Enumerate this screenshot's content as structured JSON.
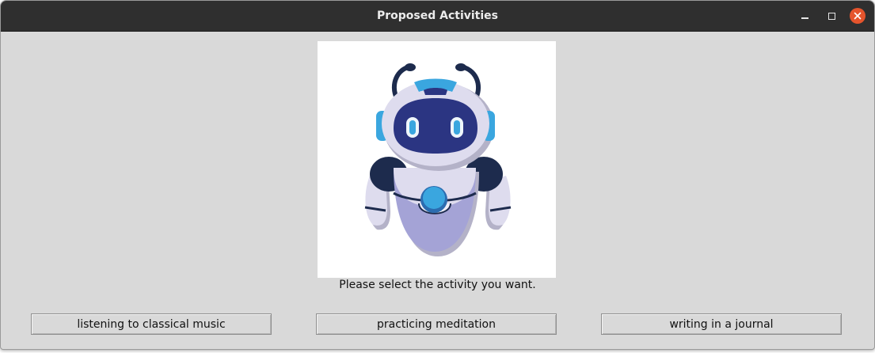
{
  "window": {
    "title": "Proposed Activities",
    "controls": [
      "minimize-icon",
      "maximize-icon",
      "close-icon"
    ]
  },
  "image": {
    "subject": "robot-illustration"
  },
  "prompt": "Please select the activity you want.",
  "buttons": [
    {
      "label": "listening to classical music"
    },
    {
      "label": "practicing meditation"
    },
    {
      "label": "writing in a journal"
    }
  ],
  "colors": {
    "titlebar": "#2f2f2f",
    "window_bg": "#d9d9d9",
    "close_button": "#e5542c",
    "robot_body": "#dedcee",
    "robot_visor": "#2b3582",
    "robot_accent": "#3aa6df",
    "robot_dark": "#1d2b4d"
  }
}
